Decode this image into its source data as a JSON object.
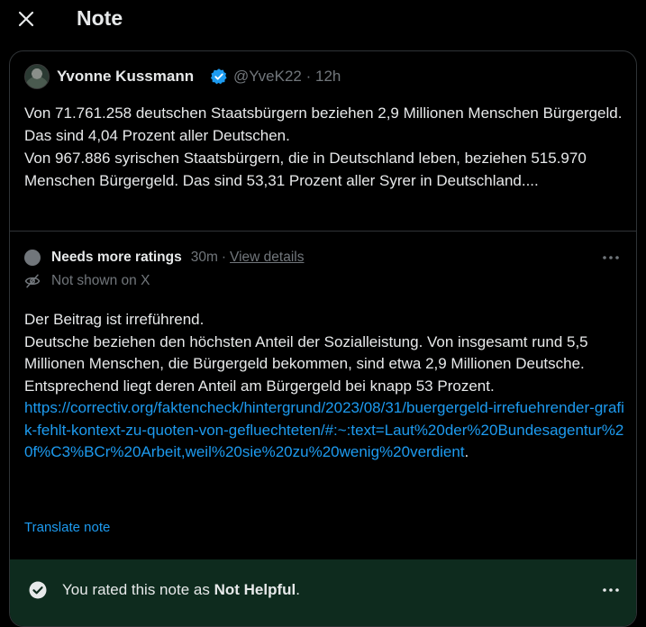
{
  "header": {
    "title": "Note",
    "close_icon": "close-icon"
  },
  "post": {
    "author_name": "Yvonne Kussmann",
    "verified_icon": "verified-badge-icon",
    "handle": "@YveK22",
    "separator": "·",
    "time": "12h",
    "text": "Von 71.761.258 deutschen Staatsbürgern beziehen 2,9 Millionen Menschen Bürgergeld. Das sind 4,04 Prozent aller Deutschen.\nVon 967.886 syrischen Staatsbürgern, die in Deutschland leben, beziehen 515.970 Menschen Bürgergeld. Das sind 53,31 Prozent aller Syrer in Deutschland...."
  },
  "note": {
    "status_label": "Needs more ratings",
    "time": "30m",
    "separator": "·",
    "view_details_label": "View details",
    "more_icon": "more-horizontal-icon",
    "not_shown_icon": "eye-off-icon",
    "not_shown_label": "Not shown on X",
    "body_text": "Der Beitrag ist irreführend.\nDeutsche beziehen den höchsten Anteil der Sozialleistung. Von insgesamt rund 5,5 Millionen Menschen, die Bürgergeld bekommen, sind etwa 2,9 Millionen Deutsche. Entsprechend liegt deren Anteil am Bürgergeld bei knapp 53 Prozent.\n",
    "link": "https://correctiv.org/faktencheck/hintergrund/2023/08/31/buergergeld-irrefuehrender-grafik-fehlt-kontext-zu-quoten-von-gefluechteten/#:~:text=Laut%20der%20Bundesagentur%20f%C3%BCr%20Arbeit,weil%20sie%20zu%20wenig%20verdient",
    "link_suffix": ".",
    "translate_label": "Translate note"
  },
  "rating": {
    "check_icon": "check-circle-icon",
    "prefix": "You rated this note as ",
    "value": "Not Helpful",
    "suffix": ".",
    "more_icon": "more-horizontal-icon",
    "background_color": "#0e2b1e"
  },
  "colors": {
    "background": "#000000",
    "text": "#e7e9ea",
    "muted": "#71767b",
    "link": "#1d9bf0",
    "border": "#2f3336",
    "verified": "#1d9bf0"
  }
}
